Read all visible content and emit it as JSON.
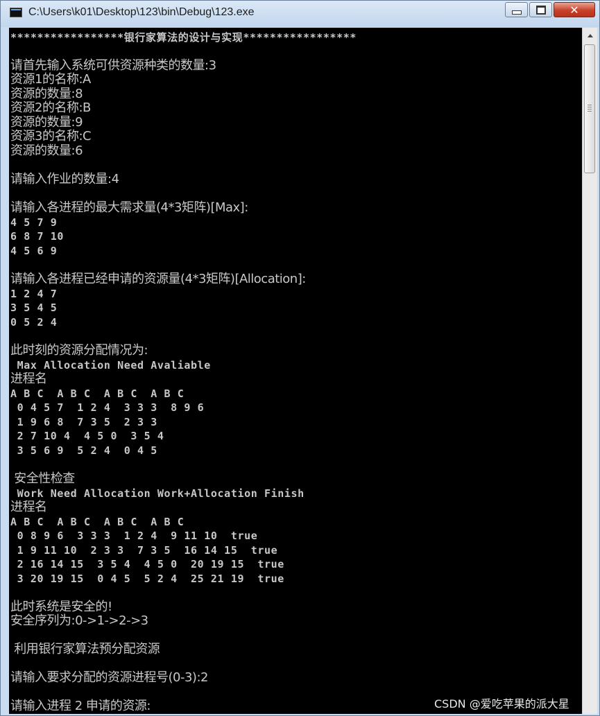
{
  "window": {
    "title": "C:\\Users\\k01\\Desktop\\123\\bin\\Debug\\123.exe",
    "close_glyph": "✕"
  },
  "console": {
    "lines": [
      {
        "kind": "mono",
        "text": "*****************银行家算法的设计与实现*****************"
      },
      {
        "kind": "cn",
        "text": "请首先输入系统可供资源种类的数量:3"
      },
      {
        "kind": "cn",
        "text": "资源1的名称:A"
      },
      {
        "kind": "cn",
        "text": "资源的数量:8"
      },
      {
        "kind": "cn",
        "text": "资源2的名称:B"
      },
      {
        "kind": "cn",
        "text": "资源的数量:9"
      },
      {
        "kind": "cn",
        "text": "资源3的名称:C"
      },
      {
        "kind": "cn",
        "text": "资源的数量:6"
      },
      {
        "kind": "cn",
        "text": "请输入作业的数量:4"
      },
      {
        "kind": "cn",
        "text": "请输入各进程的最大需求量(4*3矩阵)[Max]:"
      },
      {
        "kind": "mono",
        "text": "4 5 7 9"
      },
      {
        "kind": "mono",
        "text": "6 8 7 10"
      },
      {
        "kind": "mono",
        "text": "4 5 6 9"
      },
      {
        "kind": "cn",
        "text": "请输入各进程已经申请的资源量(4*3矩阵)[Allocation]:"
      },
      {
        "kind": "mono",
        "text": "1 2 4 7"
      },
      {
        "kind": "mono",
        "text": "3 5 4 5"
      },
      {
        "kind": "mono",
        "text": "0 5 2 4"
      },
      {
        "kind": "cn",
        "text": "此时刻的资源分配情况为:"
      },
      {
        "kind": "mono",
        "text": " Max Allocation Need Avaliable"
      },
      {
        "kind": "cn",
        "text": "进程名"
      },
      {
        "kind": "mono",
        "text": "A B C  A B C  A B C  A B C"
      },
      {
        "kind": "mono",
        "text": " 0 4 5 7  1 2 4  3 3 3  8 9 6"
      },
      {
        "kind": "mono",
        "text": " 1 9 6 8  7 3 5  2 3 3"
      },
      {
        "kind": "mono",
        "text": " 2 7 10 4  4 5 0  3 5 4"
      },
      {
        "kind": "mono",
        "text": " 3 5 6 9  5 2 4  0 4 5"
      },
      {
        "kind": "cn",
        "text": " 安全性检查"
      },
      {
        "kind": "mono",
        "text": " Work Need Allocation Work+Allocation Finish"
      },
      {
        "kind": "cn",
        "text": "进程名"
      },
      {
        "kind": "mono",
        "text": "A B C  A B C  A B C  A B C"
      },
      {
        "kind": "mono",
        "text": " 0 8 9 6  3 3 3  1 2 4  9 11 10  true"
      },
      {
        "kind": "mono",
        "text": " 1 9 11 10  2 3 3  7 3 5  16 14 15  true"
      },
      {
        "kind": "mono",
        "text": " 2 16 14 15  3 5 4  4 5 0  20 19 15  true"
      },
      {
        "kind": "mono",
        "text": " 3 20 19 15  0 4 5  5 2 4  25 21 19  true"
      },
      {
        "kind": "cn",
        "text": "此时系统是安全的!"
      },
      {
        "kind": "cn",
        "text": "安全序列为:0->1->2->3"
      },
      {
        "kind": "cn",
        "text": " 利用银行家算法预分配资源"
      },
      {
        "kind": "cn",
        "text": "请输入要求分配的资源进程号(0-3):2"
      },
      {
        "kind": "cn",
        "text": "请输入进程 2 申请的资源:"
      }
    ]
  },
  "watermark": "CSDN @爱吃苹果的派大星"
}
